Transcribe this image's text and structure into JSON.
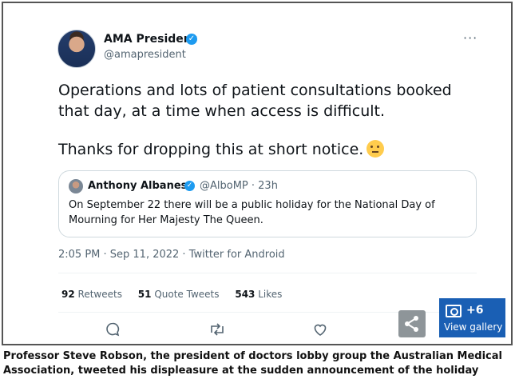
{
  "tweet": {
    "author_name": "AMA President",
    "author_handle": "@amapresident",
    "more_label": "···",
    "text_p1": "Operations and lots of patient consultations booked that day, at a time when access is difficult.",
    "text_p2": "Thanks for dropping this at short notice.",
    "emoji_name": "face-with-rolling-eyes-icon",
    "timestamp": "2:05 PM · Sep 11, 2022 · Twitter for Android",
    "stats": {
      "retweets_count": "92",
      "retweets_label": "Retweets",
      "quotes_count": "51",
      "quotes_label": "Quote Tweets",
      "likes_count": "543",
      "likes_label": "Likes"
    }
  },
  "quoted_tweet": {
    "author_name": "Anthony Albanese",
    "author_handle_time": "@AlboMP · 23h",
    "text": "On September 22 there will be a public holiday for the National Day of Mourning for Her Majesty The Queen."
  },
  "gallery": {
    "count": "+6",
    "label": "View gallery"
  },
  "caption": "Professor Steve Robson, the president of doctors lobby group the Australian Medical Association, tweeted his displeasure at the sudden announcement of the holiday",
  "colors": {
    "verified": "#1d9bf0",
    "gallery_bg": "#1a5fb4",
    "muted_text": "#536471"
  }
}
